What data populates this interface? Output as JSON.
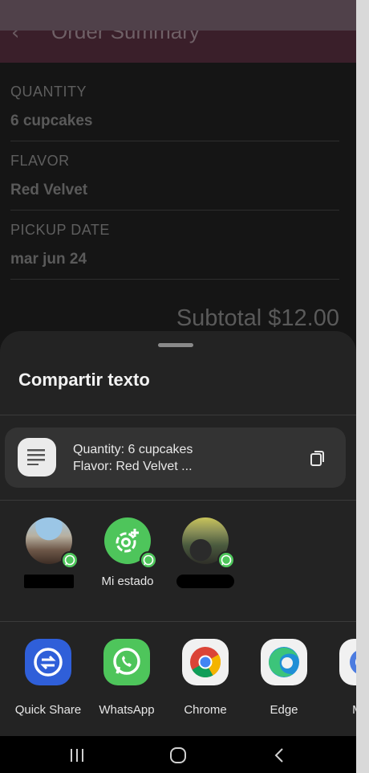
{
  "background_app": {
    "title": "Order Summary",
    "fields": [
      {
        "label": "QUANTITY",
        "value": "6 cupcakes"
      },
      {
        "label": "FLAVOR",
        "value": "Red Velvet"
      },
      {
        "label": "PICKUP DATE",
        "value": "mar jun 24"
      }
    ],
    "subtotal": "Subtotal $12.00"
  },
  "share_sheet": {
    "title": "Compartir texto",
    "preview": {
      "line1": "Quantity: 6 cupcakes",
      "line2": "Flavor: Red Velvet ..."
    },
    "contacts": [
      {
        "name": "",
        "redacted": true
      },
      {
        "name": "Mi estado",
        "redacted": false
      },
      {
        "name": "",
        "redacted": true
      }
    ],
    "apps": [
      {
        "label": "Quick Share",
        "icon": "quick-share-icon"
      },
      {
        "label": "WhatsApp",
        "icon": "whatsapp-icon"
      },
      {
        "label": "Chrome",
        "icon": "chrome-icon"
      },
      {
        "label": "Edge",
        "icon": "edge-icon"
      },
      {
        "label": "Mer",
        "icon": "messages-icon"
      }
    ]
  },
  "navbar": {
    "buttons": [
      "recents-icon",
      "home-icon",
      "back-icon"
    ]
  },
  "colors": {
    "sheet_bg": "#232323",
    "whatsapp_green": "#4ec55b",
    "quick_share_blue": "#2f5fd9",
    "topbar": "#3a1f2a"
  }
}
